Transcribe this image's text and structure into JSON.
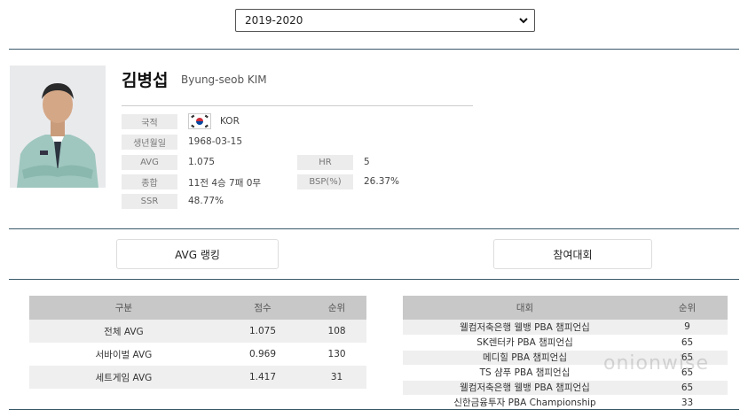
{
  "season_select": {
    "value": "2019-2020"
  },
  "player": {
    "name_ko": "김병섭",
    "name_en": "Byung-seob KIM",
    "fields": {
      "nationality_label": "국적",
      "nationality_value": "KOR",
      "birth_label": "생년월일",
      "birth_value": "1968-03-15",
      "avg_label": "AVG",
      "avg_value": "1.075",
      "hr_label": "HR",
      "hr_value": "5",
      "record_label": "종합",
      "record_value": "11전 4승 7패 0무",
      "bsp_label": "BSP(%)",
      "bsp_value": "26.37%",
      "ssr_label": "SSR",
      "ssr_value": "48.77%"
    }
  },
  "tabs": {
    "avg_ranking": "AVG 랭킹",
    "tournaments": "참여대회"
  },
  "avg_table": {
    "headers": [
      "구분",
      "점수",
      "순위"
    ],
    "rows": [
      [
        "전체 AVG",
        "1.075",
        "108"
      ],
      [
        "서바이벌 AVG",
        "0.969",
        "130"
      ],
      [
        "세트게임 AVG",
        "1.417",
        "31"
      ]
    ]
  },
  "tournament_table": {
    "headers": [
      "대회",
      "순위"
    ],
    "rows": [
      [
        "웰컴저축은행 웰뱅 PBA 챔피언십",
        "9"
      ],
      [
        "SK렌터카 PBA 챔피언십",
        "65"
      ],
      [
        "메디힐 PBA 챔피언십",
        "65"
      ],
      [
        "TS 샴푸 PBA 챔피언십",
        "65"
      ],
      [
        "웰컴저축은행 웰뱅 PBA 챔피언십",
        "65"
      ],
      [
        "신한금융투자 PBA Championship",
        "33"
      ]
    ]
  },
  "watermark": "onionwise"
}
